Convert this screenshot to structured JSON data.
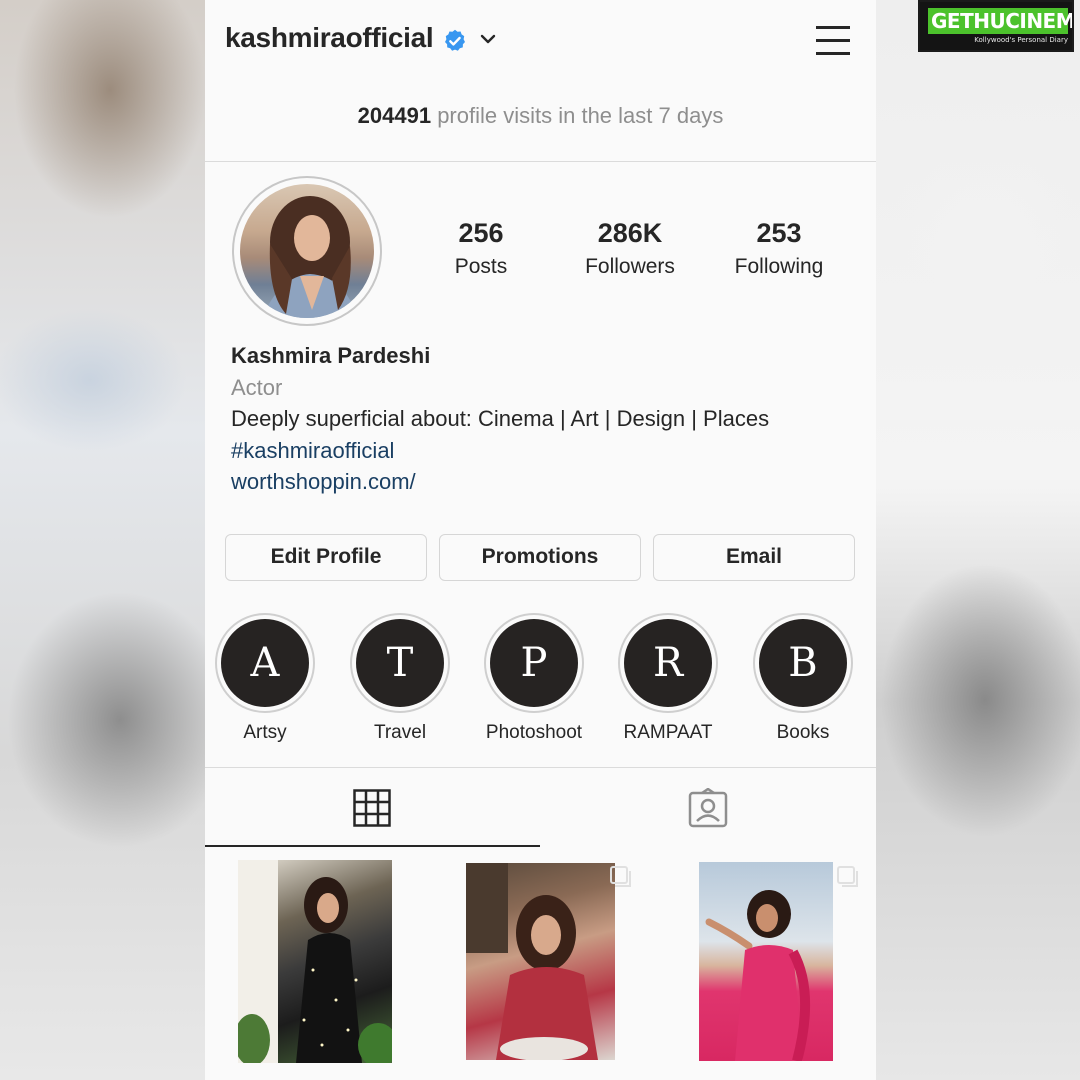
{
  "watermark": {
    "brand": "GETHUCINEMA",
    "tagline": "Kollywood's Personal Diary"
  },
  "header": {
    "username": "kashmiraofficial",
    "verified_icon": "verified-badge-icon",
    "dropdown_icon": "chevron-down-icon",
    "menu_icon": "hamburger-menu-icon"
  },
  "insights": {
    "visits_count": "204491",
    "visits_text": " profile visits in the last 7 days"
  },
  "stats": [
    {
      "value": "256",
      "label": "Posts"
    },
    {
      "value": "286K",
      "label": "Followers"
    },
    {
      "value": "253",
      "label": "Following"
    }
  ],
  "bio": {
    "name": "Kashmira Pardeshi",
    "category": "Actor",
    "description": "Deeply superficial about: Cinema | Art | Design | Places",
    "hashtag": "#kashmiraofficial",
    "website": "worthshoppin.com/"
  },
  "buttons": {
    "edit_profile": "Edit Profile",
    "promotions": "Promotions",
    "email": "Email"
  },
  "highlights": [
    {
      "letter": "A",
      "label": "Artsy"
    },
    {
      "letter": "T",
      "label": "Travel"
    },
    {
      "letter": "P",
      "label": "Photoshoot"
    },
    {
      "letter": "R",
      "label": "RAMPAAT"
    },
    {
      "letter": "B",
      "label": "Books"
    }
  ],
  "tabs": {
    "grid_icon": "grid-icon",
    "tagged_icon": "tagged-user-icon",
    "active": "grid"
  },
  "colors": {
    "link": "#1a3f63",
    "verified": "#3897f0",
    "text": "#262626",
    "muted": "#8e8e8e",
    "watermark_green": "#4cc22c"
  }
}
